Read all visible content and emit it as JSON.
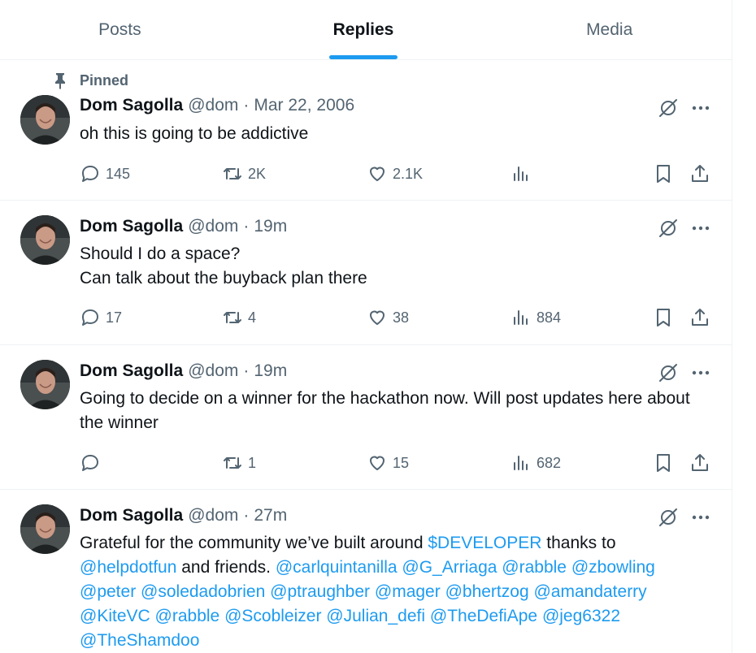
{
  "tabs": [
    {
      "label": "Posts",
      "active": false
    },
    {
      "label": "Replies",
      "active": true
    },
    {
      "label": "Media",
      "active": false
    }
  ],
  "colors": {
    "accent": "#1d9bf0",
    "text": "#0f1419",
    "secondary": "#536471",
    "border": "#eff3f4"
  },
  "icons": {
    "pin": "pin-icon",
    "grok": "grok-icon",
    "more": "more-icon",
    "reply": "reply-icon",
    "retweet": "retweet-icon",
    "like": "heart-icon",
    "views": "views-icon",
    "bookmark": "bookmark-icon",
    "share": "share-icon"
  },
  "tweets": [
    {
      "pinned": true,
      "pinned_label": "Pinned",
      "author": {
        "name": "Dom Sagolla",
        "handle": "@dom"
      },
      "separator": "·",
      "time": "Mar 22, 2006",
      "text": "oh this is going to be addictive",
      "replies": "145",
      "retweets": "2K",
      "likes": "2.1K",
      "views": ""
    },
    {
      "pinned": false,
      "author": {
        "name": "Dom Sagolla",
        "handle": "@dom"
      },
      "separator": "·",
      "time": "19m",
      "text_lines": [
        "Should I do a space?",
        "Can talk about the buyback plan there"
      ],
      "replies": "17",
      "retweets": "4",
      "likes": "38",
      "views": "884"
    },
    {
      "pinned": false,
      "author": {
        "name": "Dom Sagolla",
        "handle": "@dom"
      },
      "separator": "·",
      "time": "19m",
      "text": "Going to decide on a winner for the hackathon now. Will post updates here about the winner",
      "replies": "",
      "retweets": "1",
      "likes": "15",
      "views": "682"
    },
    {
      "pinned": false,
      "author": {
        "name": "Dom Sagolla",
        "handle": "@dom"
      },
      "separator": "·",
      "time": "27m",
      "text_segments": [
        {
          "text": "Grateful for the community we’ve built around ",
          "link": false
        },
        {
          "text": "$DEVELOPER",
          "link": true
        },
        {
          "text": " thanks to ",
          "link": false
        },
        {
          "text": "@helpdotfun",
          "link": true
        },
        {
          "text": " and friends. ",
          "link": false
        },
        {
          "text": "@carlquintanilla",
          "link": true
        },
        {
          "text": " ",
          "link": false
        },
        {
          "text": "@G_Arriaga",
          "link": true
        },
        {
          "text": " ",
          "link": false
        },
        {
          "text": "@rabble",
          "link": true
        },
        {
          "text": " ",
          "link": false
        },
        {
          "text": "@zbowling",
          "link": true
        },
        {
          "text": " ",
          "link": false
        },
        {
          "text": "@peter",
          "link": true
        },
        {
          "text": " ",
          "link": false
        },
        {
          "text": "@soledadobrien",
          "link": true
        },
        {
          "text": " ",
          "link": false
        },
        {
          "text": "@ptraughber",
          "link": true
        },
        {
          "text": " ",
          "link": false
        },
        {
          "text": "@mager",
          "link": true
        },
        {
          "text": " ",
          "link": false
        },
        {
          "text": "@bhertzog",
          "link": true
        },
        {
          "text": " ",
          "link": false
        },
        {
          "text": "@amandaterry",
          "link": true
        },
        {
          "text": " ",
          "link": false
        },
        {
          "text": "@KiteVC",
          "link": true
        },
        {
          "text": " ",
          "link": false
        },
        {
          "text": "@rabble",
          "link": true
        },
        {
          "text": " ",
          "link": false
        },
        {
          "text": "@Scobleizer",
          "link": true
        },
        {
          "text": " ",
          "link": false
        },
        {
          "text": "@Julian_defi",
          "link": true
        },
        {
          "text": " ",
          "link": false
        },
        {
          "text": "@TheDefiApe",
          "link": true
        },
        {
          "text": " ",
          "link": false
        },
        {
          "text": "@jeg6322",
          "link": true
        },
        {
          "text": " ",
          "link": false
        },
        {
          "text": "@TheShamdoo",
          "link": true
        }
      ]
    }
  ]
}
